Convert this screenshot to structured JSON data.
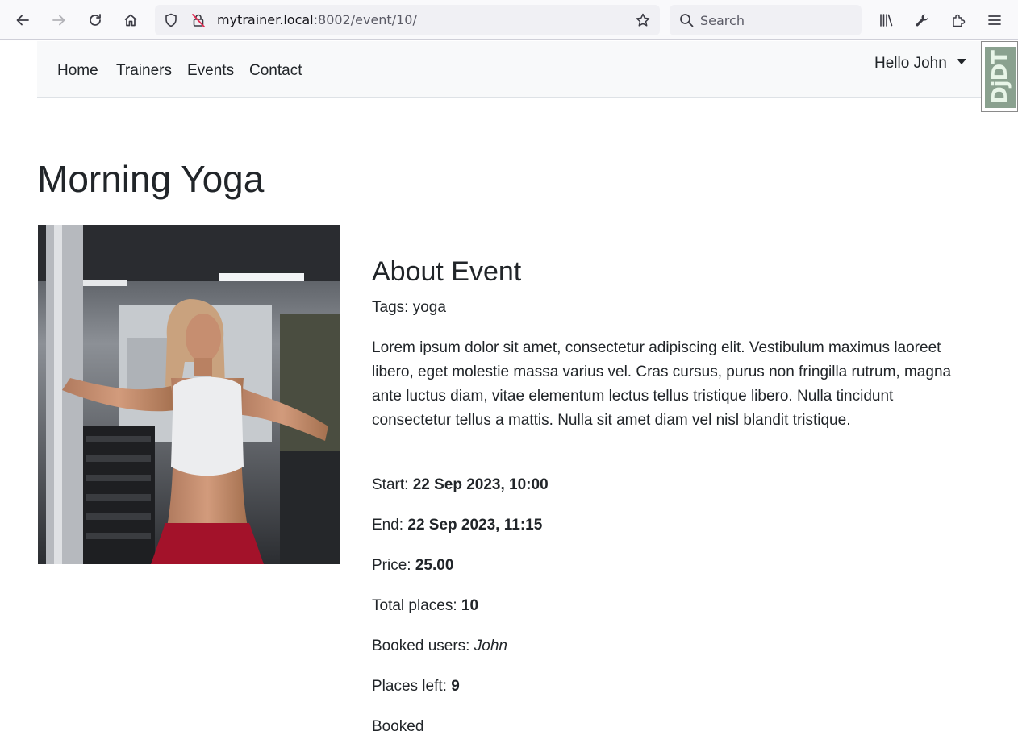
{
  "browser": {
    "url_host": "mytrainer.local",
    "url_rest": ":8002/event/10/",
    "search_placeholder": "Search"
  },
  "navbar": {
    "links": [
      "Home",
      "Trainers",
      "Events",
      "Contact"
    ],
    "user_menu": "Hello John"
  },
  "debug_toolbar": {
    "label": "DjDT"
  },
  "event": {
    "title": "Morning Yoga",
    "about_heading": "About Event",
    "tags_label": "Tags: ",
    "tags": "yoga",
    "description": "Lorem ipsum dolor sit amet, consectetur adipiscing elit. Vestibulum maximus laoreet libero, eget molestie massa varius vel. Cras cursus, purus non fringilla rutrum, magna ante luctus diam, vitae elementum lectus tellus tristique libero. Nulla tincidunt consectetur tellus a mattis. Nulla sit amet diam vel nisl blandit tristique.",
    "start_label": "Start: ",
    "start": "22 Sep 2023, 10:00",
    "end_label": "End: ",
    "end": "22 Sep 2023, 11:15",
    "price_label": "Price: ",
    "price": "25.00",
    "total_places_label": "Total places: ",
    "total_places": "10",
    "booked_users_label": "Booked users: ",
    "booked_users": "John",
    "places_left_label": "Places left: ",
    "places_left": "9",
    "status": "Booked"
  }
}
